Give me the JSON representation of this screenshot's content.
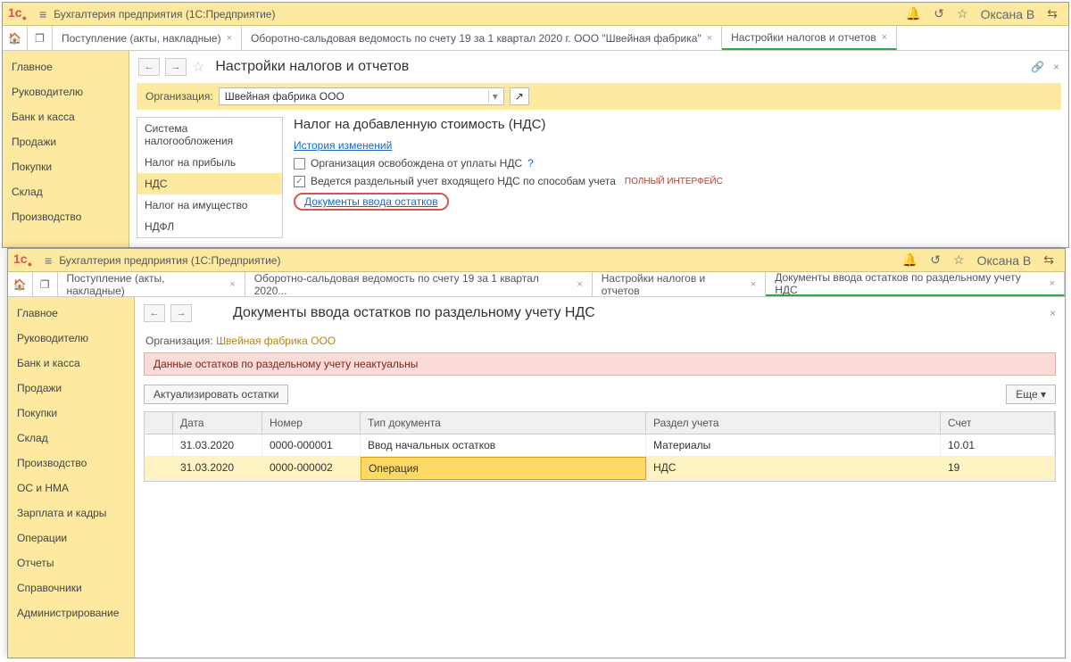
{
  "app": {
    "title": "Бухгалтерия предприятия  (1С:Предприятие)",
    "user": "Оксана В"
  },
  "tabs1": [
    {
      "label": "Поступление (акты, накладные)"
    },
    {
      "label": "Оборотно-сальдовая ведомость по счету 19 за 1 квартал 2020 г. ООО \"Швейная фабрика\""
    },
    {
      "label": "Настройки налогов и отчетов",
      "active": true
    }
  ],
  "sidebar1": [
    "Главное",
    "Руководителю",
    "Банк и касса",
    "Продажи",
    "Покупки",
    "Склад",
    "Производство"
  ],
  "page1": {
    "title": "Настройки налогов и отчетов",
    "org_label": "Организация:",
    "org_value": "Швейная фабрика ООО",
    "settings_items": [
      "Система налогообложения",
      "Налог на прибыль",
      "НДС",
      "Налог на имущество",
      "НДФЛ"
    ],
    "settings_selected": "НДС",
    "heading": "Налог на добавленную стоимость (НДС)",
    "history_link": "История изменений",
    "chk1": "Организация освобождена от уплаты НДС",
    "chk2": "Ведется раздельный учет входящего НДС по способам учета",
    "badge": "полный интерфейс",
    "doc_link": "Документы ввода остатков"
  },
  "tabs2": [
    {
      "label": "Поступление (акты, накладные)"
    },
    {
      "label": "Оборотно-сальдовая ведомость по счету 19 за 1 квартал 2020..."
    },
    {
      "label": "Настройки налогов и отчетов"
    },
    {
      "label": "Документы ввода остатков по раздельному учету НДС",
      "active": true
    }
  ],
  "sidebar2": [
    "Главное",
    "Руководителю",
    "Банк и касса",
    "Продажи",
    "Покупки",
    "Склад",
    "Производство",
    "ОС и НМА",
    "Зарплата и кадры",
    "Операции",
    "Отчеты",
    "Справочники",
    "Администрирование"
  ],
  "page2": {
    "title": "Документы ввода остатков по раздельному учету НДС",
    "org_label": "Организация:",
    "org_value": "Швейная фабрика ООО",
    "warning": "Данные остатков по раздельному учету неактуальны",
    "btn_actualize": "Актуализировать остатки",
    "btn_more": "Еще",
    "columns": [
      "",
      "Дата",
      "Номер",
      "Тип документа",
      "Раздел учета",
      "Счет"
    ],
    "rows": [
      {
        "date": "31.03.2020",
        "num": "0000-000001",
        "type": "Ввод начальных остатков",
        "section": "Материалы",
        "acct": "10.01"
      },
      {
        "date": "31.03.2020",
        "num": "0000-000002",
        "type": "Операция",
        "section": "НДС",
        "acct": "19",
        "sel": true
      }
    ]
  }
}
